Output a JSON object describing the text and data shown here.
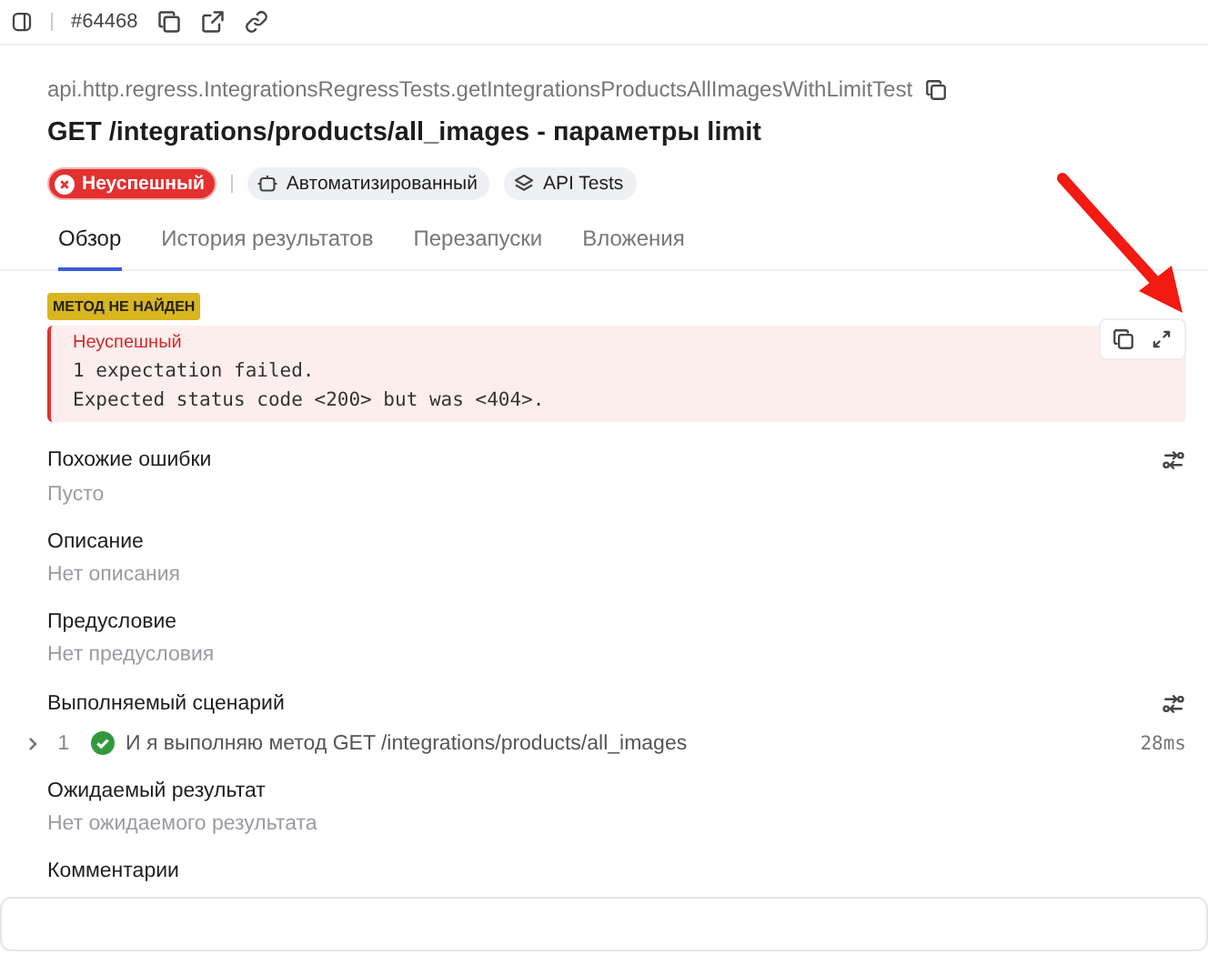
{
  "toolbar": {
    "id": "#64468"
  },
  "header": {
    "path": "api.http.regress.IntegrationsRegressTests.getIntegrationsProductsAllImagesWithLimitTest",
    "title": "GET /integrations/products/all_images - параметры limit",
    "status": {
      "label": "Неуспешный",
      "kind": "failed"
    },
    "tags": [
      {
        "label": "Автоматизированный",
        "kind": "robot"
      },
      {
        "label": "API Tests",
        "kind": "layers"
      }
    ]
  },
  "tabs": [
    {
      "label": "Обзор",
      "selected": true
    },
    {
      "label": "История результатов",
      "selected": false
    },
    {
      "label": "Перезапуски",
      "selected": false
    },
    {
      "label": "Вложения",
      "selected": false
    }
  ],
  "error": {
    "category": "МЕТОД НЕ НАЙДЕН",
    "status": "Неуспешный",
    "lines": [
      "1 expectation failed.",
      "Expected status code <200> but was <404>."
    ]
  },
  "sections": [
    {
      "kind": "text",
      "title": "Похожие ошибки",
      "value": "Пусто",
      "action": true
    },
    {
      "kind": "text",
      "title": "Описание",
      "value": "Нет описания",
      "action": false
    },
    {
      "kind": "text",
      "title": "Предусловие",
      "value": "Нет предусловия",
      "action": false
    },
    {
      "kind": "steps",
      "title": "Выполняемый сценарий",
      "action": true,
      "steps": [
        {
          "number": "1",
          "text": "И я выполняю метод GET /integrations/products/all_images",
          "duration": "28ms",
          "expanded": false
        }
      ]
    },
    {
      "kind": "text",
      "title": "Ожидаемый результат",
      "value": "Нет ожидаемого результата",
      "action": false
    },
    {
      "kind": "comments",
      "title": "Комментарии",
      "action": false
    }
  ]
}
